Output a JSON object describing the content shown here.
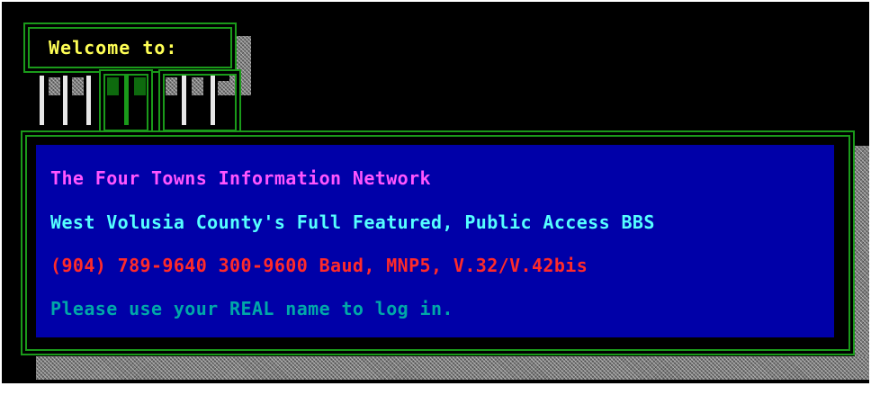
{
  "welcome": {
    "label": "Welcome to:"
  },
  "banner": {
    "line1": "The Four Towns Information Network",
    "line2": "West Volusia County's Full Featured, Public Access BBS",
    "line3": "(904) 789-9640  300-9600 Baud, MNP5, V.32/V.42bis",
    "line4": "Please use your REAL name to log in."
  },
  "colors": {
    "background": "#000000",
    "panel": "#0000a8",
    "frame": "#1a9a1a",
    "welcome_text": "#ffff55",
    "line1": "#ff55ff",
    "line2": "#55ffff",
    "line3": "#ff2a2a",
    "line4": "#00a8a8"
  }
}
